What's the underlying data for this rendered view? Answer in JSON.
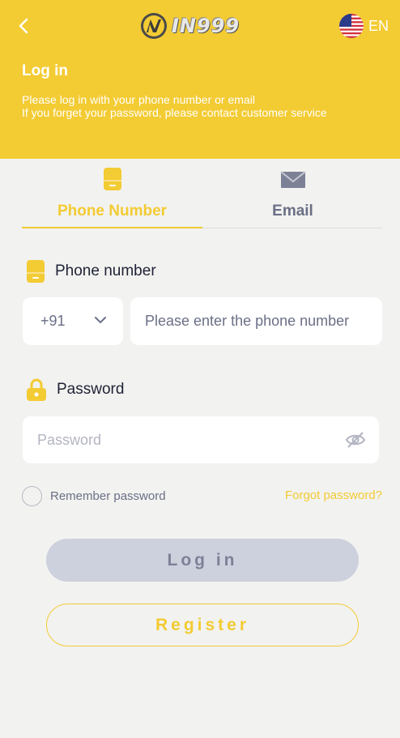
{
  "header": {
    "logo_text": "IN999",
    "language": "EN",
    "title": "Log in",
    "subtitle_line1": "Please log in with your phone number or email",
    "subtitle_line2": "If you forget your password, please contact customer service"
  },
  "tabs": [
    {
      "label": "Phone Number",
      "icon": "phone-icon",
      "active": true
    },
    {
      "label": "Email",
      "icon": "email-icon",
      "active": false
    }
  ],
  "form": {
    "phone_label": "Phone number",
    "country_code": "+91",
    "phone_placeholder": "Please enter the phone number",
    "password_label": "Password",
    "password_placeholder": "Password",
    "remember_label": "Remember password",
    "forgot_label": "Forgot password?"
  },
  "buttons": {
    "login": "Log in",
    "register": "Register"
  },
  "colors": {
    "accent": "#f3cb33",
    "background": "#f2f2f0",
    "muted_text": "#6b6f86",
    "login_button": "#cdd0dd"
  }
}
